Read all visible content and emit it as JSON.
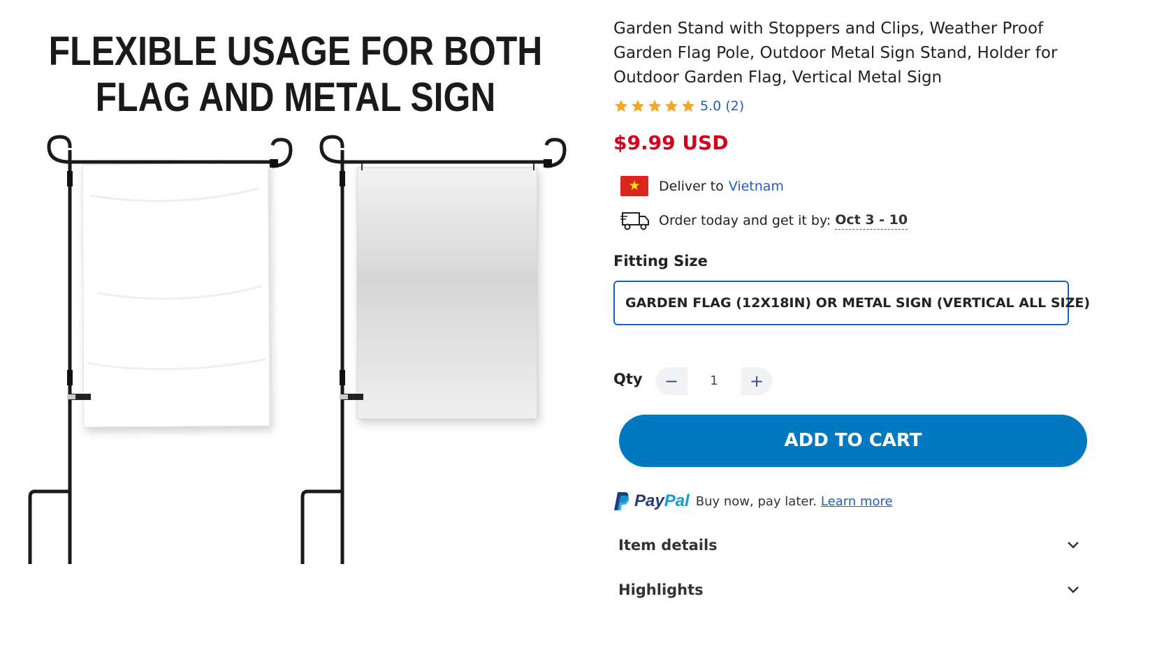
{
  "image": {
    "headline_line1": "FLEXIBLE USAGE FOR BOTH",
    "headline_line2": "FLAG AND METAL SIGN"
  },
  "product": {
    "title": "Garden Stand with Stoppers and Clips, Weather Proof Garden Flag Pole, Outdoor Metal Sign Stand, Holder for Outdoor Garden Flag, Vertical Metal Sign",
    "rating": "5.0 (2)",
    "stars": 5,
    "price": "$9.99 USD",
    "price_color": "#d0021b"
  },
  "delivery": {
    "deliver_label": "Deliver to",
    "country": "Vietnam",
    "flag_star": "★",
    "order_text": "Order today and get it by:",
    "order_date": "Oct 3 - 10"
  },
  "options": {
    "size_label": "Fitting Size",
    "size_value": "GARDEN FLAG (12X18IN) OR METAL SIGN (VERTICAL ALL SIZE)"
  },
  "quantity": {
    "label": "Qty",
    "value": "1",
    "minus": "−",
    "plus": "+"
  },
  "cart": {
    "add_label": "ADD TO CART",
    "accent": "#0079c1"
  },
  "paypal": {
    "word_pay": "Pay",
    "word_pal": "Pal",
    "text": "Buy now, pay later.",
    "link": "Learn more"
  },
  "accordions": [
    {
      "label": "Item details"
    },
    {
      "label": "Highlights"
    }
  ]
}
